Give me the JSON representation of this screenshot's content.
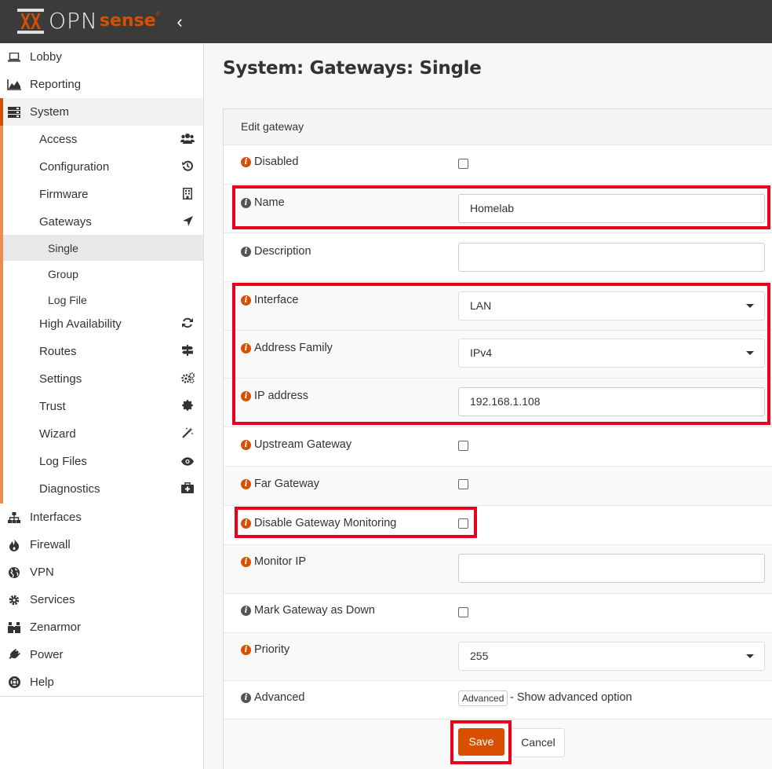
{
  "header": {
    "logo_text": "OPN",
    "logo_sense": "sense",
    "logo_reg": "®",
    "collapse_glyph": "‹"
  },
  "sidebar": {
    "top_items": [
      {
        "label": "Lobby",
        "icon": "laptop-icon"
      },
      {
        "label": "Reporting",
        "icon": "area-chart-icon"
      },
      {
        "label": "System",
        "icon": "server-icon"
      }
    ],
    "system_items": [
      {
        "label": "Access",
        "icon": "users-icon"
      },
      {
        "label": "Configuration",
        "icon": "history-icon"
      },
      {
        "label": "Firmware",
        "icon": "building-icon"
      },
      {
        "label": "Gateways",
        "icon": "location-arrow-icon"
      }
    ],
    "gateway_items": [
      {
        "label": "Single"
      },
      {
        "label": "Group"
      },
      {
        "label": "Log File"
      }
    ],
    "system_items_2": [
      {
        "label": "High Availability",
        "icon": "refresh-icon"
      },
      {
        "label": "Routes",
        "icon": "signpost-icon"
      },
      {
        "label": "Settings",
        "icon": "cogs-icon"
      },
      {
        "label": "Trust",
        "icon": "certificate-icon"
      },
      {
        "label": "Wizard",
        "icon": "magic-icon"
      },
      {
        "label": "Log Files",
        "icon": "eye-icon"
      },
      {
        "label": "Diagnostics",
        "icon": "medkit-icon"
      }
    ],
    "bottom_items": [
      {
        "label": "Interfaces",
        "icon": "sitemap-icon"
      },
      {
        "label": "Firewall",
        "icon": "fire-icon"
      },
      {
        "label": "VPN",
        "icon": "globe-icon"
      },
      {
        "label": "Services",
        "icon": "cog-icon"
      },
      {
        "label": "Zenarmor",
        "icon": "binoculars-icon"
      },
      {
        "label": "Power",
        "icon": "plug-icon"
      },
      {
        "label": "Help",
        "icon": "life-ring-icon"
      }
    ]
  },
  "main": {
    "page_title": "System: Gateways: Single",
    "panel_title": "Edit gateway",
    "fields": {
      "disabled": {
        "label": "Disabled",
        "checked": false
      },
      "name": {
        "label": "Name",
        "value": "Homelab"
      },
      "description": {
        "label": "Description",
        "value": ""
      },
      "interface": {
        "label": "Interface",
        "value": "LAN"
      },
      "address_family": {
        "label": "Address Family",
        "value": "IPv4"
      },
      "ip_address": {
        "label": "IP address",
        "value": "192.168.1.108"
      },
      "upstream_gateway": {
        "label": "Upstream Gateway",
        "checked": false
      },
      "far_gateway": {
        "label": "Far Gateway",
        "checked": false
      },
      "disable_monitoring": {
        "label": "Disable Gateway Monitoring",
        "checked": false
      },
      "monitor_ip": {
        "label": "Monitor IP",
        "value": ""
      },
      "mark_down": {
        "label": "Mark Gateway as Down",
        "checked": false
      },
      "priority": {
        "label": "Priority",
        "value": "255"
      },
      "advanced": {
        "label": "Advanced",
        "button": "Advanced",
        "text": "- Show advanced option"
      }
    },
    "save_label": "Save",
    "cancel_label": "Cancel"
  },
  "colors": {
    "accent": "#d94f00",
    "highlight": "#e8001c",
    "topbar": "#3b3b3b"
  }
}
